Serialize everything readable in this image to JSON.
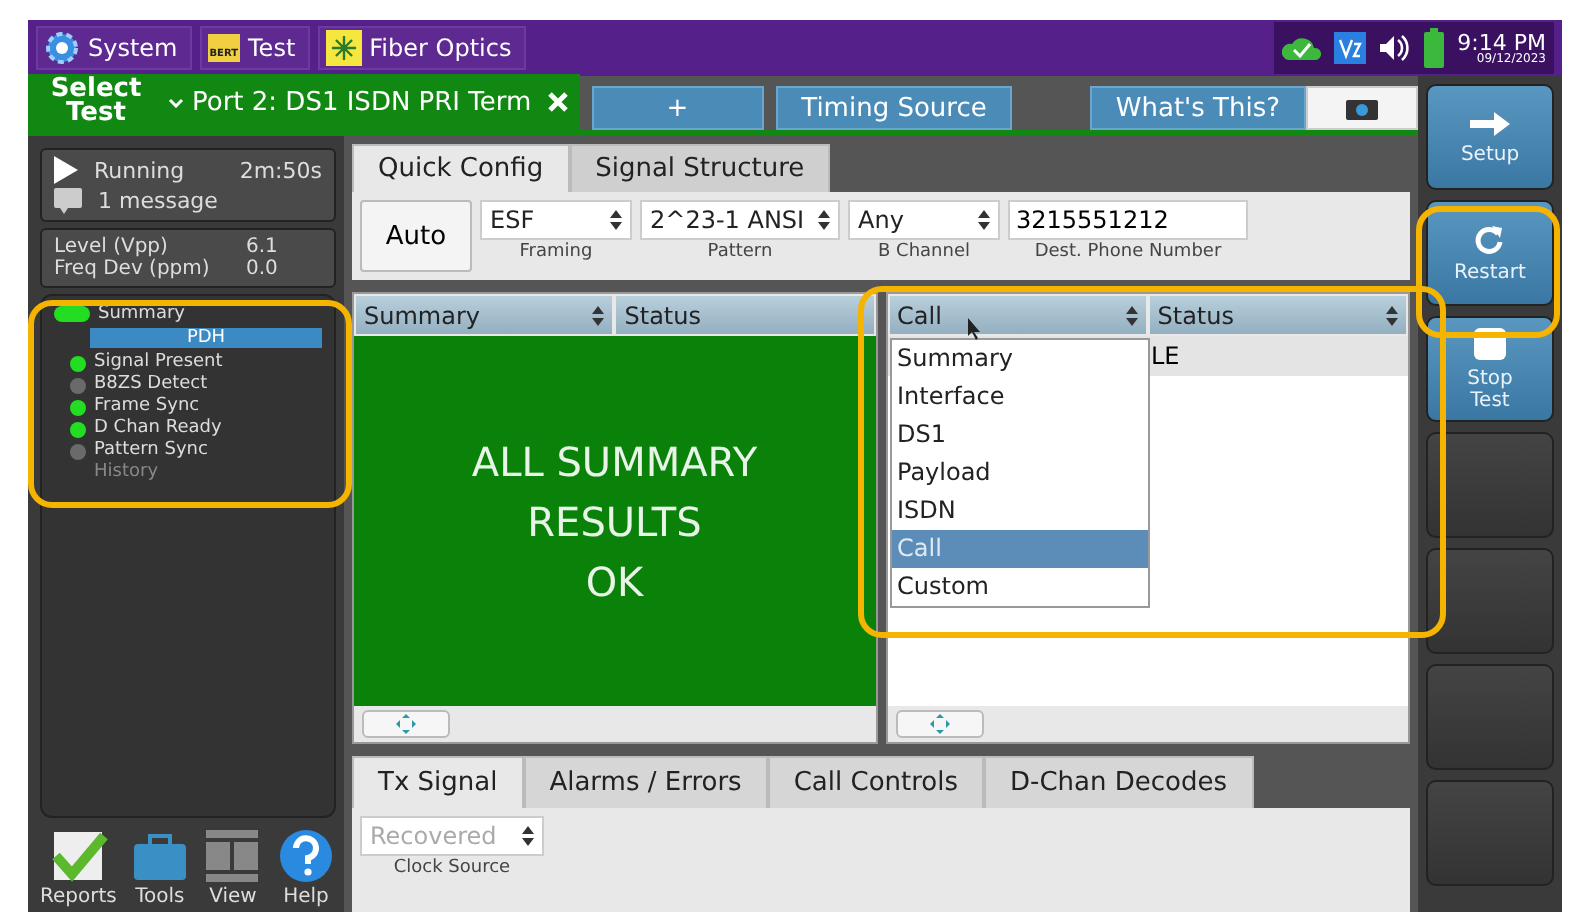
{
  "top_bar": {
    "apps": [
      {
        "kind": "system",
        "label": "System"
      },
      {
        "kind": "test",
        "label": "Test",
        "badge": "BERT"
      },
      {
        "kind": "fiber",
        "label": "Fiber Optics"
      }
    ],
    "time": "9:14 PM",
    "date": "09/12/2023"
  },
  "test_tabs": {
    "select_label": "Select Test",
    "port": "Port 2: DS1 ISDN PRI Term",
    "tabs": [
      "+",
      "Timing Source"
    ],
    "help": "What's This?"
  },
  "status_panel": {
    "state": "Running",
    "elapsed": "2m:50s",
    "message": "1 message",
    "measurements": [
      {
        "label": "Level (Vpp)",
        "value": "6.1"
      },
      {
        "label": "Freq Dev (ppm)",
        "value": "0.0"
      }
    ],
    "summary": {
      "label": "Summary",
      "color": "#22dd22"
    },
    "group": "PDH",
    "leds": [
      {
        "label": "Signal Present",
        "color": "#22dd22"
      },
      {
        "label": "B8ZS Detect",
        "color": "#6a6a6a"
      },
      {
        "label": "Frame Sync",
        "color": "#22dd22"
      },
      {
        "label": "D Chan Ready",
        "color": "#22dd22"
      },
      {
        "label": "Pattern Sync",
        "color": "#6a6a6a"
      }
    ],
    "history": "History"
  },
  "tools": [
    {
      "kind": "reports",
      "label": "Reports"
    },
    {
      "kind": "tools",
      "label": "Tools"
    },
    {
      "kind": "view",
      "label": "View"
    },
    {
      "kind": "help",
      "label": "Help"
    }
  ],
  "config_tabs": [
    {
      "label": "Quick Config",
      "selected": true
    },
    {
      "label": "Signal Structure",
      "selected": false
    }
  ],
  "quick_config": {
    "auto": "Auto",
    "fields": [
      {
        "kind": "select",
        "value": "ESF",
        "label": "Framing"
      },
      {
        "kind": "select",
        "value": "2^23-1 ANSI",
        "label": "Pattern"
      },
      {
        "kind": "select",
        "value": "Any",
        "label": "B Channel"
      },
      {
        "kind": "input",
        "value": "3215551212",
        "label": "Dest. Phone Number"
      }
    ]
  },
  "left_pane": {
    "category": "Summary",
    "view": "Status",
    "lines": [
      "ALL SUMMARY",
      "RESULTS",
      "OK"
    ]
  },
  "right_pane": {
    "category": "Call",
    "view": "Status",
    "partial": "LE",
    "options": [
      {
        "label": "Summary",
        "selected": false
      },
      {
        "label": "Interface",
        "selected": false
      },
      {
        "label": "DS1",
        "selected": false
      },
      {
        "label": "Payload",
        "selected": false
      },
      {
        "label": "ISDN",
        "selected": false
      },
      {
        "label": "Call",
        "selected": true
      },
      {
        "label": "Custom",
        "selected": false
      }
    ]
  },
  "bottom_tabs": [
    {
      "label": "Tx Signal",
      "selected": true
    },
    {
      "label": "Alarms / Errors",
      "selected": false
    },
    {
      "label": "Call Controls",
      "selected": false
    },
    {
      "label": "D-Chan Decodes",
      "selected": false
    }
  ],
  "clock_source": {
    "value": "Recovered",
    "label": "Clock Source",
    "disabled": true
  },
  "side_buttons": [
    {
      "kind": "setup",
      "label": "Setup"
    },
    {
      "kind": "restart",
      "label": "Restart"
    },
    {
      "kind": "stop",
      "label": "Stop Test"
    },
    {
      "kind": "blank"
    },
    {
      "kind": "blank"
    },
    {
      "kind": "blank"
    },
    {
      "kind": "blank"
    }
  ]
}
